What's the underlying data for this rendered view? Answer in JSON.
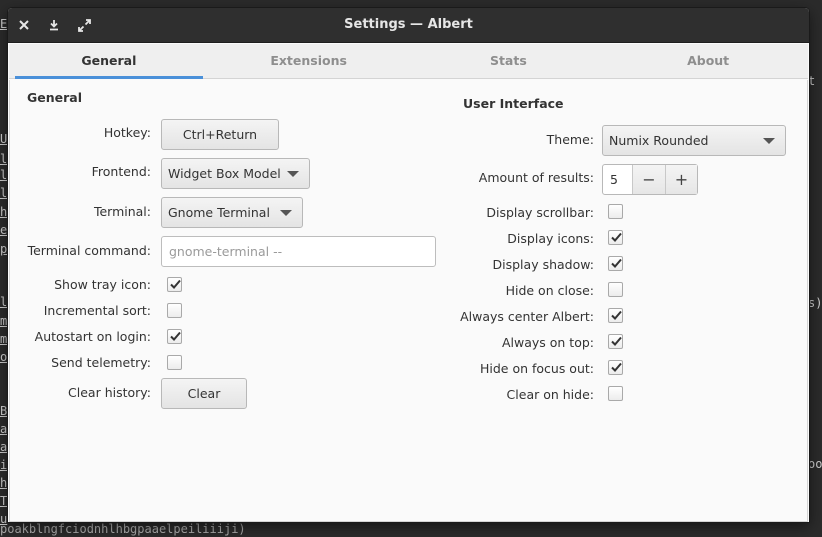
{
  "window": {
    "title": "Settings — Albert"
  },
  "tabs": [
    {
      "label": "General"
    },
    {
      "label": "Extensions"
    },
    {
      "label": "Stats"
    },
    {
      "label": "About"
    }
  ],
  "general": {
    "heading": "General",
    "hotkey": {
      "label": "Hotkey:",
      "value": "Ctrl+Return"
    },
    "frontend": {
      "label": "Frontend:",
      "value": "Widget Box Model"
    },
    "terminal": {
      "label": "Terminal:",
      "value": "Gnome Terminal"
    },
    "terminal_command": {
      "label": "Terminal command:",
      "placeholder": "gnome-terminal --"
    },
    "show_tray_icon": {
      "label": "Show tray icon:",
      "checked": true
    },
    "incremental_sort": {
      "label": "Incremental sort:",
      "checked": false
    },
    "autostart": {
      "label": "Autostart on login:",
      "checked": true
    },
    "send_telemetry": {
      "label": "Send telemetry:",
      "checked": false
    },
    "clear_history": {
      "label": "Clear history:",
      "button": "Clear"
    }
  },
  "ui": {
    "heading": "User Interface",
    "theme": {
      "label": "Theme:",
      "value": "Numix Rounded"
    },
    "results": {
      "label": "Amount of results:",
      "value": "5",
      "minus": "−",
      "plus": "+"
    },
    "display_scrollbar": {
      "label": "Display scrollbar:",
      "checked": false
    },
    "display_icons": {
      "label": "Display icons:",
      "checked": true
    },
    "display_shadow": {
      "label": "Display shadow:",
      "checked": true
    },
    "hide_on_close": {
      "label": "Hide on close:",
      "checked": false
    },
    "always_center": {
      "label": "Always center Albert:",
      "checked": true
    },
    "always_on_top": {
      "label": "Always on top:",
      "checked": true
    },
    "hide_on_focus_out": {
      "label": "Hide on focus out:",
      "checked": true
    },
    "clear_on_hide": {
      "label": "Clear on hide:",
      "checked": false
    }
  },
  "background": {
    "left_chars": [
      "E",
      "U",
      "l",
      "l",
      "l",
      "h",
      "e",
      "p",
      "l",
      "m",
      "m",
      "o",
      "B",
      "a",
      "a",
      "i",
      "h",
      "T",
      "u"
    ],
    "bottom_text": "poakblngfciodnhlhbgpaaelpeiliiiji)",
    "right_chars": [
      "t",
      "s)",
      "oo"
    ]
  },
  "colors": {
    "accent": "#4a90d9",
    "titlebar": "#2f2f2f"
  }
}
